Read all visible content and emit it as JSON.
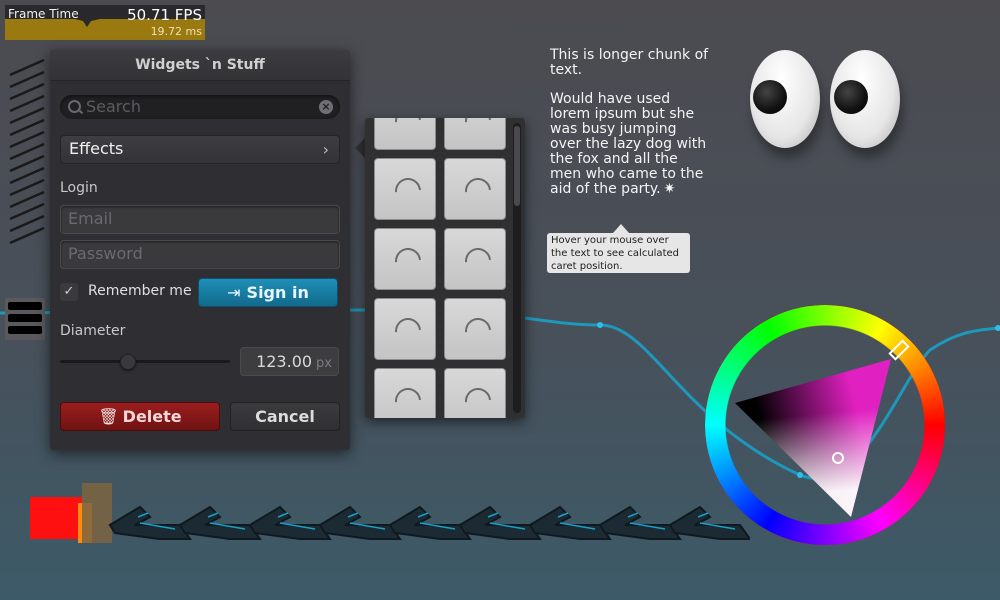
{
  "perf": {
    "label": "Frame Time",
    "fps": "50.71 FPS",
    "ms": "19.72 ms",
    "bar_color": "#9a7a10"
  },
  "window": {
    "title": "Widgets `n Stuff",
    "search_placeholder": "Search",
    "dropdown_label": "Effects",
    "login_label": "Login",
    "email_placeholder": "Email",
    "password_placeholder": "Password",
    "remember_label": "Remember me",
    "remember_checked": true,
    "signin_label": "Sign in",
    "diameter_label": "Diameter",
    "diameter_value": "123.00",
    "diameter_unit": "px",
    "slider_value": 0.4,
    "delete_label": "Delete",
    "cancel_label": "Cancel"
  },
  "text_demo": {
    "para1": "This is longer chunk of text.",
    "para2": "Would have used lorem ipsum but she was busy jumping over the lazy dog with the fox and all the men who came to the aid of the party.",
    "tooltip": "Hover your mouse over the text to see calculated caret position."
  },
  "icons": {
    "search": "search-icon",
    "clear": "clear-icon",
    "chevron": "chevron-right-icon",
    "check": "check-icon",
    "login": "login-icon",
    "trash": "trash-icon"
  },
  "colors": {
    "accent": "#1a86ad",
    "danger": "#8a1a1a",
    "line": "#1aa0c8"
  }
}
